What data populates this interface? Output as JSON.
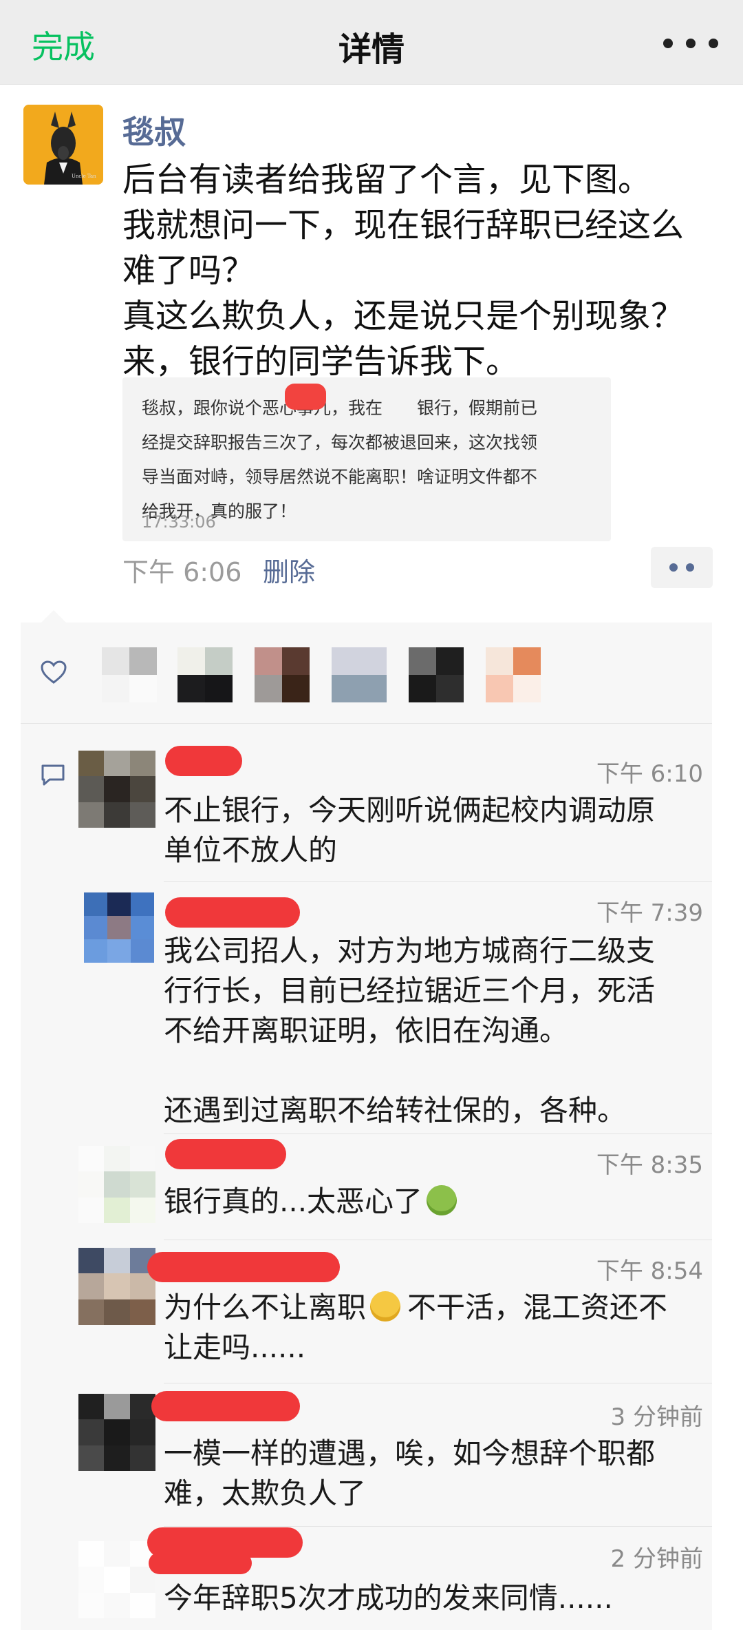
{
  "nav": {
    "done_label": "完成",
    "title": "详情",
    "more_icon": "more-dots-icon"
  },
  "post": {
    "author": "毯叔",
    "lines": [
      "后台有读者给我留了个言，见下图。",
      "我就想问一下，现在银行辞职已经这么",
      "难了吗？",
      "真这么欺负人，还是说只是个别现象？",
      "来，银行的同学告诉我下。"
    ],
    "quote": {
      "lines": [
        "毯叔，跟你说个恶心事儿，我在　　银行，假期前已",
        "经提交辞职报告三次了，每次都被退回来，这次找领",
        "导当面对峙，领导居然说不能离职！啥证明文件都不",
        "给我开，真的服了！"
      ],
      "time": "17:33:06"
    },
    "time": "下午 6:06",
    "delete_label": "删除"
  },
  "likes": {
    "icon": "heart-icon"
  },
  "comments": [
    {
      "time": "下午 6:10",
      "lines": [
        "不止银行，今天刚听说俩起校内调动原",
        "单位不放人的"
      ]
    },
    {
      "time": "下午 7:39",
      "lines": [
        "我公司招人，对方为地方城商行二级支",
        "行行长，目前已经拉锯近三个月，死活",
        "不给开离职证明，依旧在沟通。",
        "",
        "还遇到过离职不给转社保的，各种。"
      ]
    },
    {
      "time": "下午 8:35",
      "lines": [
        "银行真的...太恶心了"
      ]
    },
    {
      "time": "下午 8:54",
      "lines": [
        "为什么不让离职",
        "让走吗......"
      ],
      "line1_tail": "不干活，混工资还不"
    },
    {
      "time": "3 分钟前",
      "lines": [
        "一模一样的遭遇，唉，如今想辞个职都",
        "难，太欺负人了"
      ]
    },
    {
      "time": "2 分钟前",
      "lines": [
        "今年辞职5次才成功的发来同情......"
      ]
    }
  ],
  "colors": {
    "accent_green": "#07c160",
    "link_blue": "#576b95",
    "redaction_red": "#f0383a"
  }
}
